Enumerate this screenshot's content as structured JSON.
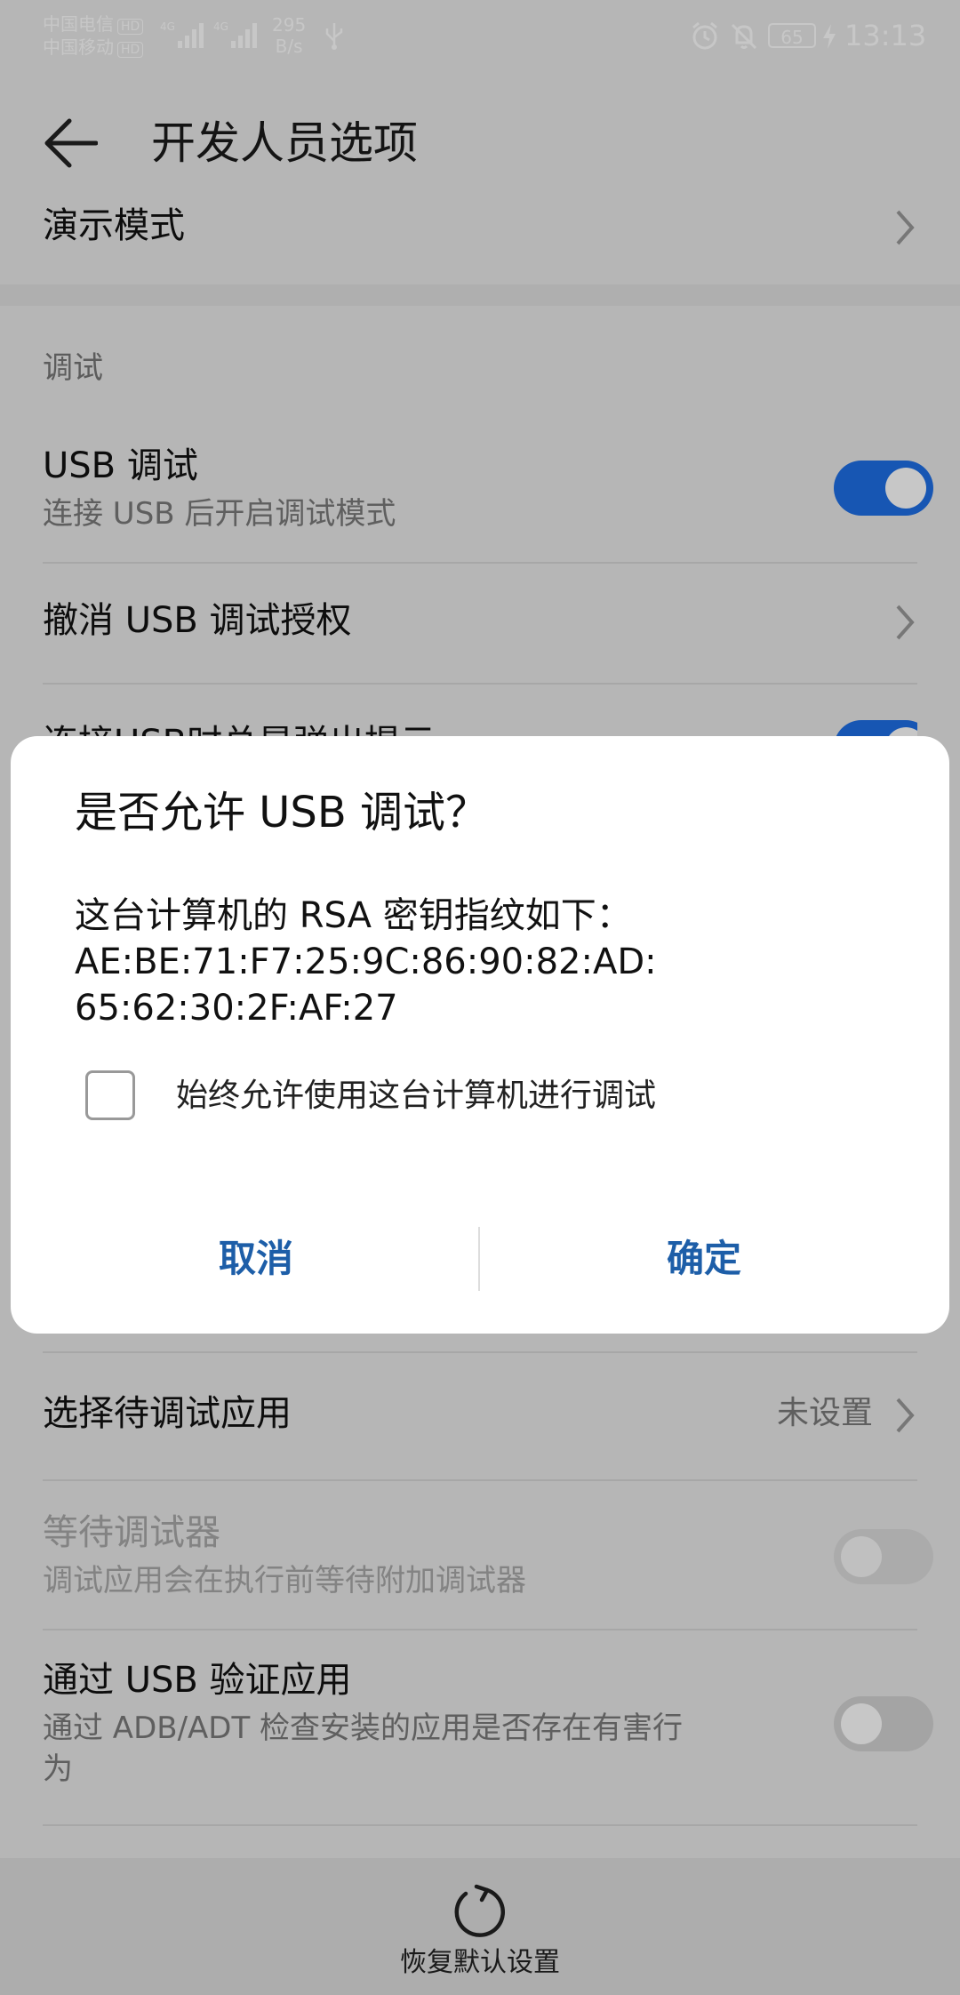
{
  "status_bar": {
    "carrier1": "中国电信",
    "carrier2": "中国移动",
    "hd": "HD",
    "net_label": "4G",
    "speed_value": "295",
    "speed_unit": "B/s",
    "battery": "65",
    "time": "13:13"
  },
  "app_bar": {
    "title": "开发人员选项"
  },
  "items": {
    "demo_mode": {
      "label": "演示模式"
    },
    "section_debug": "调试",
    "usb_debug": {
      "label": "USB 调试",
      "summary": "连接 USB 后开启调试模式",
      "on": true
    },
    "revoke": {
      "label": "撤消 USB 调试授权"
    },
    "partial_hidden": {
      "label": "连接USB时总是弹出提示"
    },
    "select_app": {
      "label": "选择待调试应用",
      "value": "未设置"
    },
    "wait_debugger": {
      "label": "等待调试器",
      "summary": "调试应用会在执行前等待附加调试器",
      "on": false
    },
    "verify_usb": {
      "label": "通过 USB 验证应用",
      "summary_line1": "通过 ADB/ADT 检查安装的应用是否存在有害行",
      "summary_line2": "为",
      "on": false
    }
  },
  "dialog": {
    "title": "是否允许 USB 调试？",
    "message_lines": [
      "这台计算机的 RSA 密钥指纹如下：",
      "AE:BE:71:F7:25:9C:86:90:82:AD:",
      "65:62:30:2F:AF:27"
    ],
    "checkbox_label": "始终允许使用这台计算机进行调试",
    "checkbox_checked": false,
    "cancel": "取消",
    "ok": "确定"
  },
  "bottom": {
    "restore_label": "恢复默认设置"
  },
  "colors": {
    "accent": "#1e6fe6",
    "dialog_button": "#1d5ea8"
  }
}
